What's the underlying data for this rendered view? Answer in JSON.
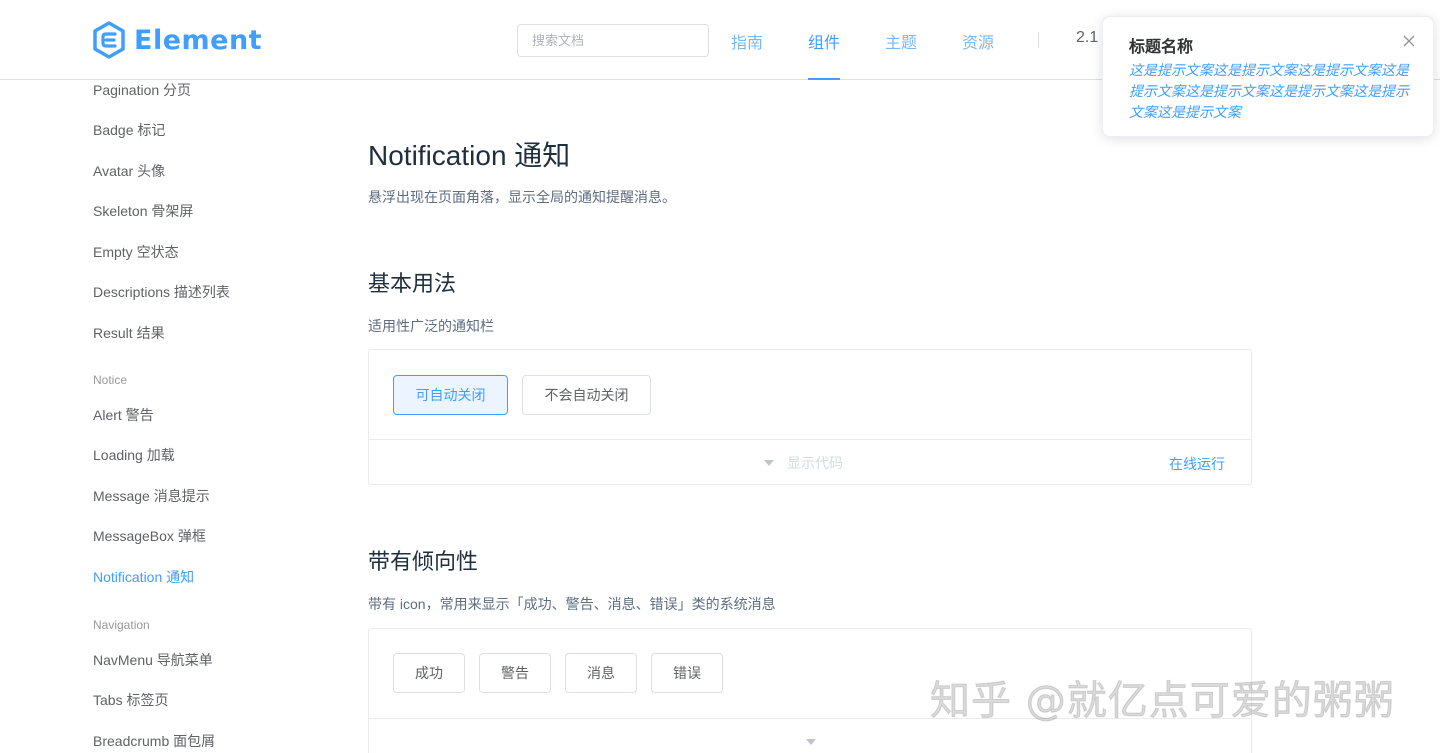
{
  "header": {
    "logo_text": "Element",
    "search_placeholder": "搜索文档",
    "nav": [
      "指南",
      "组件",
      "主题",
      "资源"
    ],
    "active_nav": "组件",
    "version": "2.1"
  },
  "sidebar": {
    "items_top": [
      "Pagination 分页",
      "Badge 标记",
      "Avatar 头像",
      "Skeleton 骨架屏",
      "Empty 空状态",
      "Descriptions 描述列表",
      "Result 结果"
    ],
    "group_notice": "Notice",
    "items_notice": [
      "Alert 警告",
      "Loading 加载",
      "Message 消息提示",
      "MessageBox 弹框",
      "Notification 通知"
    ],
    "group_navigation": "Navigation",
    "items_navigation": [
      "NavMenu 导航菜单",
      "Tabs 标签页",
      "Breadcrumb 面包屑"
    ],
    "active_item": "Notification 通知"
  },
  "main": {
    "title": "Notification 通知",
    "subtitle": "悬浮出现在页面角落，显示全局的通知提醒消息。",
    "section1": {
      "heading": "基本用法",
      "desc": "适用性广泛的通知栏",
      "buttons": [
        "可自动关闭",
        "不会自动关闭"
      ],
      "show_code": "显示代码",
      "run_online": "在线运行"
    },
    "section2": {
      "heading": "带有倾向性",
      "desc": "带有 icon，常用来显示「成功、警告、消息、错误」类的系统消息",
      "buttons": [
        "成功",
        "警告",
        "消息",
        "错误"
      ]
    }
  },
  "notification": {
    "title": "标题名称",
    "message": "这是提示文案这是提示文案这是提示文案这是提示文案这是提示文案这是提示文案这是提示文案这是提示文案",
    "close_icon": "close-icon"
  },
  "watermark": "知乎 @就亿点可爱的粥粥",
  "colors": {
    "accent": "#409eff",
    "text": "#303133",
    "muted": "#606266",
    "border": "#dcdfe6"
  }
}
